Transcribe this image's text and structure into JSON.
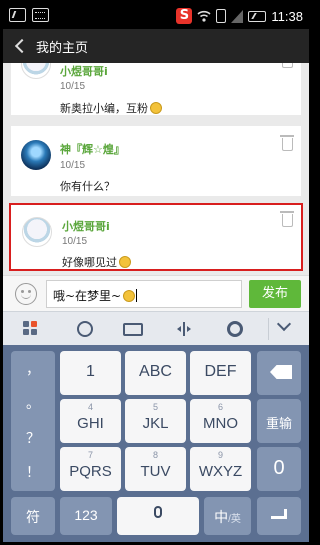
{
  "status_bar": {
    "time": "11:38",
    "app_badge": "S"
  },
  "header": {
    "title": "我的主页"
  },
  "feed": {
    "items": [
      {
        "name": "小煜哥哥i",
        "time": "10/15",
        "message": "新奥拉小编，互粉"
      },
      {
        "name": "神『辉☆煌』",
        "time": "10/15",
        "message": "你有什么？"
      },
      {
        "name": "小煜哥哥i",
        "time": "10/15",
        "message": "好像哪见过"
      }
    ]
  },
  "composer": {
    "value": "哦~在梦里~",
    "send_label": "发布"
  },
  "keyboard": {
    "side_keys": [
      "，",
      "。",
      "？",
      "！"
    ],
    "rows": [
      [
        {
          "num": "",
          "label": "1"
        },
        {
          "num": "",
          "label": "ABC"
        },
        {
          "num": "",
          "label": "DEF"
        }
      ],
      [
        {
          "num": "4",
          "label": "GHI"
        },
        {
          "num": "5",
          "label": "JKL"
        },
        {
          "num": "6",
          "label": "MNO"
        }
      ],
      [
        {
          "num": "7",
          "label": "PQRS"
        },
        {
          "num": "8",
          "label": "TUV"
        },
        {
          "num": "9",
          "label": "WXYZ"
        }
      ]
    ],
    "right_keys": {
      "reinput": "重输",
      "zero": "0"
    },
    "bottom": {
      "symbol": "符",
      "num": "123",
      "lang_main": "中",
      "lang_sub": "/英"
    }
  }
}
